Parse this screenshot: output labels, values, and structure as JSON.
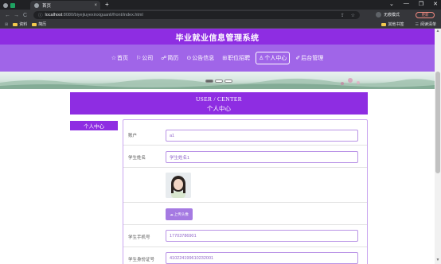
{
  "browser": {
    "tab_active_title": "首页",
    "tab_close": "×",
    "new_tab": "+",
    "window_controls": [
      "⌄",
      "—",
      "❐",
      "✕"
    ],
    "nav": {
      "back": "←",
      "forward": "→",
      "reload": "C"
    },
    "url_host": "localhost",
    "url_path": ":8080/biyejiuyexinxiguanli/front/index.html",
    "profile_label": "无痕模式",
    "update_label": "更新",
    "bookmarks": [
      "资料",
      "简历"
    ],
    "bookmarks_right": [
      "其他书签",
      "阅读清单"
    ]
  },
  "site": {
    "title": "毕业就业信息管理系统",
    "nav": [
      {
        "icon": "☆",
        "label": "首页",
        "active": false
      },
      {
        "icon": "⚐",
        "label": "公司",
        "active": false
      },
      {
        "icon": "☍",
        "label": "简历",
        "active": false
      },
      {
        "icon": "⊙",
        "label": "公告信息",
        "active": false
      },
      {
        "icon": "⊞",
        "label": "职位招聘",
        "active": false
      },
      {
        "icon": "♙",
        "label": "个人中心",
        "active": true
      },
      {
        "icon": "✐",
        "label": "后台管理",
        "active": false
      }
    ]
  },
  "section": {
    "title_en": "USER / CENTER",
    "title_cn": "个人中心"
  },
  "side_menu": {
    "item": "个人中心"
  },
  "form": {
    "account_label": "账户",
    "account_value": "a1",
    "name_label": "学生姓名",
    "name_value": "学生姓名1",
    "upload_label": "上传头像",
    "phone_label": "学生手机号",
    "phone_value": "17703786901",
    "idcard_label": "学生身份证号",
    "idcard_value": "410224199610232001"
  },
  "colors": {
    "primary": "#8e2de2",
    "nav_bg": "#a065e8",
    "input_border": "#b993e6"
  }
}
